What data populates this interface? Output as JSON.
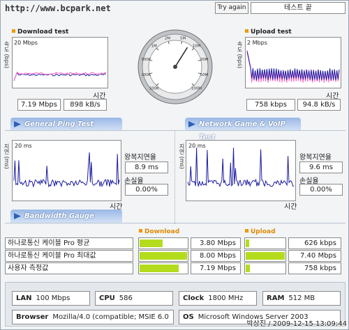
{
  "title": "http://www.bcpark.net",
  "buttons": {
    "try_again": "Try again",
    "test_done": "테스트 끝"
  },
  "download": {
    "header": "Download test",
    "ylabel": "속도 (bps)",
    "ymax": "20 Mbps",
    "xlabel": "시간",
    "mbps": "7.19 Mbps",
    "kbs": "898 kB/s"
  },
  "upload": {
    "header": "Upload test",
    "ylabel": "속도 (bps)",
    "ymax": "2 Mbps",
    "xlabel": "시간",
    "kbps": "758 kbps",
    "kbs": "94.8 kB/s"
  },
  "gauge": {
    "ticks": [
      "100K",
      "200K",
      "500K",
      "1M",
      "2M",
      "5M",
      "10M",
      "20M",
      "50M",
      "100M"
    ],
    "needle_value_mbps": 7.19
  },
  "ping": {
    "section": "General Ping Test",
    "ylabel": "지연 (ms)",
    "ymax": "20 ms",
    "xlabel": "시간",
    "rt_label": "왕복지연율",
    "rt_value": "8.9 ms",
    "loss_label": "손실율",
    "loss_value": "0.00%"
  },
  "game": {
    "section": "Network Game & VoIP Test",
    "ylabel": "지연 (ms)",
    "ymax": "20 ms",
    "xlabel": "시간",
    "rt_label": "왕복지연율",
    "rt_value": "9.6 ms",
    "loss_label": "손실율",
    "loss_value": "0.00%"
  },
  "bandwidth": {
    "section": "Bandwidth Gauge",
    "col_download": "Download",
    "col_upload": "Upload",
    "rows": [
      {
        "label": "하나로통신 케이블 Pro 평균",
        "down": "3.80 Mbps",
        "down_frac": 0.475,
        "up": "626 kbps",
        "up_frac": 0.085
      },
      {
        "label": "하나로통신 케이블 Pro 최대값",
        "down": "8.00 Mbps",
        "down_frac": 1.0,
        "up": "7.40 Mbps",
        "up_frac": 1.0
      },
      {
        "label": "사용자 측정값",
        "down": "7.19 Mbps",
        "down_frac": 0.9,
        "up": "758 kbps",
        "up_frac": 0.1
      }
    ]
  },
  "info": {
    "lan_k": "LAN",
    "lan_v": "100 Mbps",
    "cpu_k": "CPU",
    "cpu_v": "586",
    "clock_k": "Clock",
    "clock_v": "1800 MHz",
    "ram_k": "RAM",
    "ram_v": "512 MB",
    "browser_k": "Browser",
    "browser_v": "Mozilla/4.0 (compatible; MSIE 6.0",
    "os_k": "OS",
    "os_v": "Microsoft Windows Server 2003"
  },
  "footer": "박상진 / 2009-12-15 13:09:44",
  "colors": {
    "accent": "#f39800",
    "bar": "#b4dc1c",
    "section": "#9ab8e6",
    "line": "#1a1aa0",
    "pink": "#ff60c0"
  }
}
